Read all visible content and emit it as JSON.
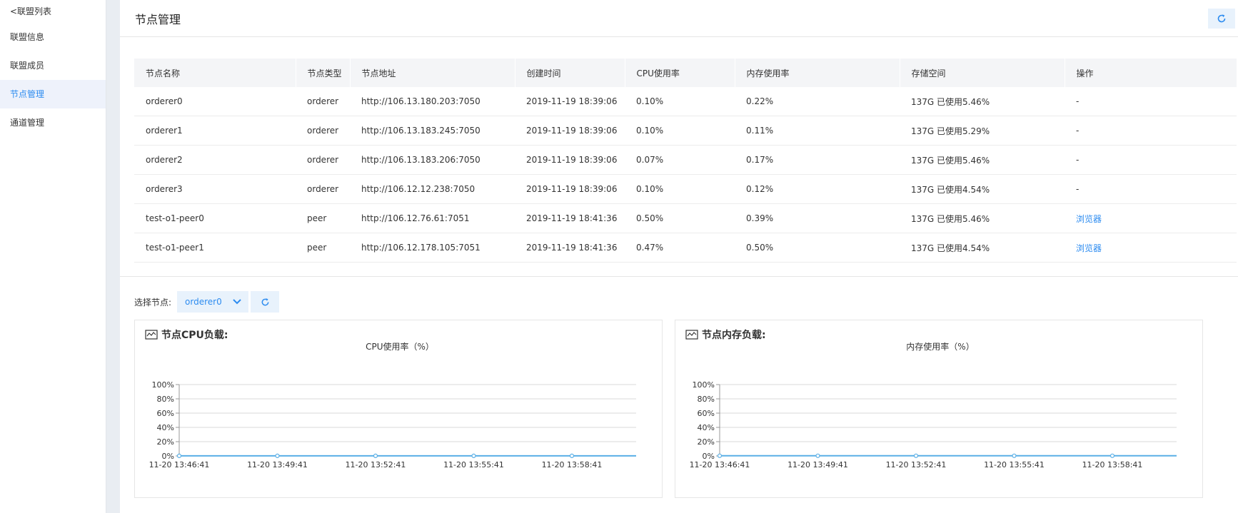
{
  "sidebar": {
    "back_label": "<联盟列表",
    "items": [
      {
        "label": "联盟信息",
        "active": false
      },
      {
        "label": "联盟成员",
        "active": false
      },
      {
        "label": "节点管理",
        "active": true
      },
      {
        "label": "通道管理",
        "active": false
      }
    ]
  },
  "header": {
    "title": "节点管理"
  },
  "table": {
    "columns": [
      "节点名称",
      "节点类型",
      "节点地址",
      "创建时间",
      "CPU使用率",
      "内存使用率",
      "存储空间",
      "操作"
    ],
    "rows": [
      [
        "orderer0",
        "orderer",
        "http://106.13.180.203:7050",
        "2019-11-19 18:39:06",
        "0.10%",
        "0.22%",
        "137G 已使用5.46%",
        "-"
      ],
      [
        "orderer1",
        "orderer",
        "http://106.13.183.245:7050",
        "2019-11-19 18:39:06",
        "0.10%",
        "0.11%",
        "137G 已使用5.29%",
        "-"
      ],
      [
        "orderer2",
        "orderer",
        "http://106.13.183.206:7050",
        "2019-11-19 18:39:06",
        "0.07%",
        "0.17%",
        "137G 已使用5.46%",
        "-"
      ],
      [
        "orderer3",
        "orderer",
        "http://106.12.12.238:7050",
        "2019-11-19 18:39:06",
        "0.10%",
        "0.12%",
        "137G 已使用4.54%",
        "-"
      ],
      [
        "test-o1-peer0",
        "peer",
        "http://106.12.76.61:7051",
        "2019-11-19 18:41:36",
        "0.50%",
        "0.39%",
        "137G 已使用5.46%",
        "浏览器"
      ],
      [
        "test-o1-peer1",
        "peer",
        "http://106.12.178.105:7051",
        "2019-11-19 18:41:36",
        "0.47%",
        "0.50%",
        "137G 已使用4.54%",
        "浏览器"
      ]
    ]
  },
  "selector": {
    "label": "选择节点:",
    "value": "orderer0"
  },
  "panels": {
    "cpu": {
      "title": "节点CPU负载:"
    },
    "mem": {
      "title": "节点内存负载:"
    }
  },
  "colors": {
    "accent": "#2d8cf0",
    "line": "#5aafe6"
  },
  "chart_data": [
    {
      "type": "line",
      "title": "CPU使用率（%）",
      "x": [
        "11-20 13:46:41",
        "11-20 13:49:41",
        "11-20 13:52:41",
        "11-20 13:55:41",
        "11-20 13:58:41"
      ],
      "y_ticks": [
        "0%",
        "20%",
        "40%",
        "60%",
        "80%",
        "100%"
      ],
      "ylim": [
        0,
        100
      ],
      "grid": true,
      "series": [
        {
          "values": [
            0.1,
            0.1,
            0.1,
            0.1,
            0.1
          ]
        }
      ]
    },
    {
      "type": "line",
      "title": "内存使用率（%）",
      "x": [
        "11-20 13:46:41",
        "11-20 13:49:41",
        "11-20 13:52:41",
        "11-20 13:55:41",
        "11-20 13:58:41"
      ],
      "y_ticks": [
        "0%",
        "20%",
        "40%",
        "60%",
        "80%",
        "100%"
      ],
      "ylim": [
        0,
        100
      ],
      "grid": true,
      "series": [
        {
          "values": [
            0.2,
            0.2,
            0.2,
            0.2,
            0.2
          ]
        }
      ]
    }
  ]
}
